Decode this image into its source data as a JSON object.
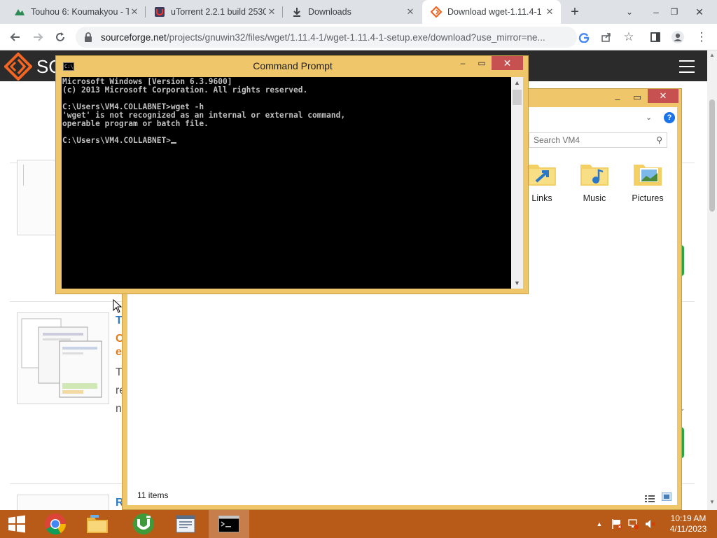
{
  "browser": {
    "tabs": [
      {
        "title": "Touhou 6: Koumakyou - T",
        "icon": "touhou-favicon"
      },
      {
        "title": "uTorrent 2.2.1 build 2530",
        "icon": "utorrent-favicon"
      },
      {
        "title": "Downloads",
        "icon": "download-icon"
      },
      {
        "title": "Download wget-1.11.4-1",
        "icon": "sourceforge-favicon",
        "active": true
      }
    ],
    "new_tab_label": "+",
    "url_host": "sourceforge.net",
    "url_path": "/projects/gnuwin32/files/wget/1.11.4-1/wget-1.11.4-1-setup.exe/download?use_mirror=ne..."
  },
  "site": {
    "logo_text": "SO",
    "card_title_initial": "T",
    "card_sub1": "C",
    "card_sub2": "e",
    "card_line1": "T",
    "card_line2": "re",
    "card_line3": "n",
    "card2_title_initial": "R"
  },
  "explorer": {
    "search_placeholder": "Search VM4",
    "folders": [
      {
        "label": "Links"
      },
      {
        "label": "Music"
      },
      {
        "label": "Pictures"
      }
    ],
    "status": "11 items"
  },
  "cmd": {
    "title": "Command Prompt",
    "icon_text": "C:\\_",
    "lines": [
      "Microsoft Windows [Version 6.3.9600]",
      "(c) 2013 Microsoft Corporation. All rights reserved.",
      "",
      "C:\\Users\\VM4.COLLABNET>wget -h",
      "'wget' is not recognized as an internal or external command,",
      "operable program or batch file.",
      "",
      "C:\\Users\\VM4.COLLABNET>"
    ]
  },
  "taskbar": {
    "time": "10:19 AM",
    "date": "4/11/2023"
  },
  "colors": {
    "taskbar": "#b85a18",
    "window_frame": "#f0c66a",
    "sourceforge_orange": "#f26522"
  }
}
